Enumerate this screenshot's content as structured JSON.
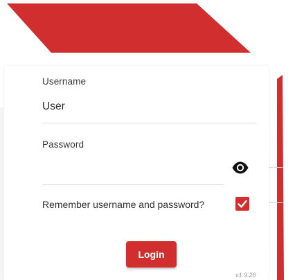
{
  "theme": {
    "accent": "#d12f2f",
    "accent_dark": "#b82626"
  },
  "login_form": {
    "username_label": "Username",
    "username_value": "User",
    "password_label": "Password",
    "password_value": "",
    "password_toggle_icon": "eye-icon",
    "remember_label": "Remember username and password?",
    "remember_checked": true,
    "login_label": "Login"
  },
  "footer": {
    "version": "v1.9.28"
  }
}
